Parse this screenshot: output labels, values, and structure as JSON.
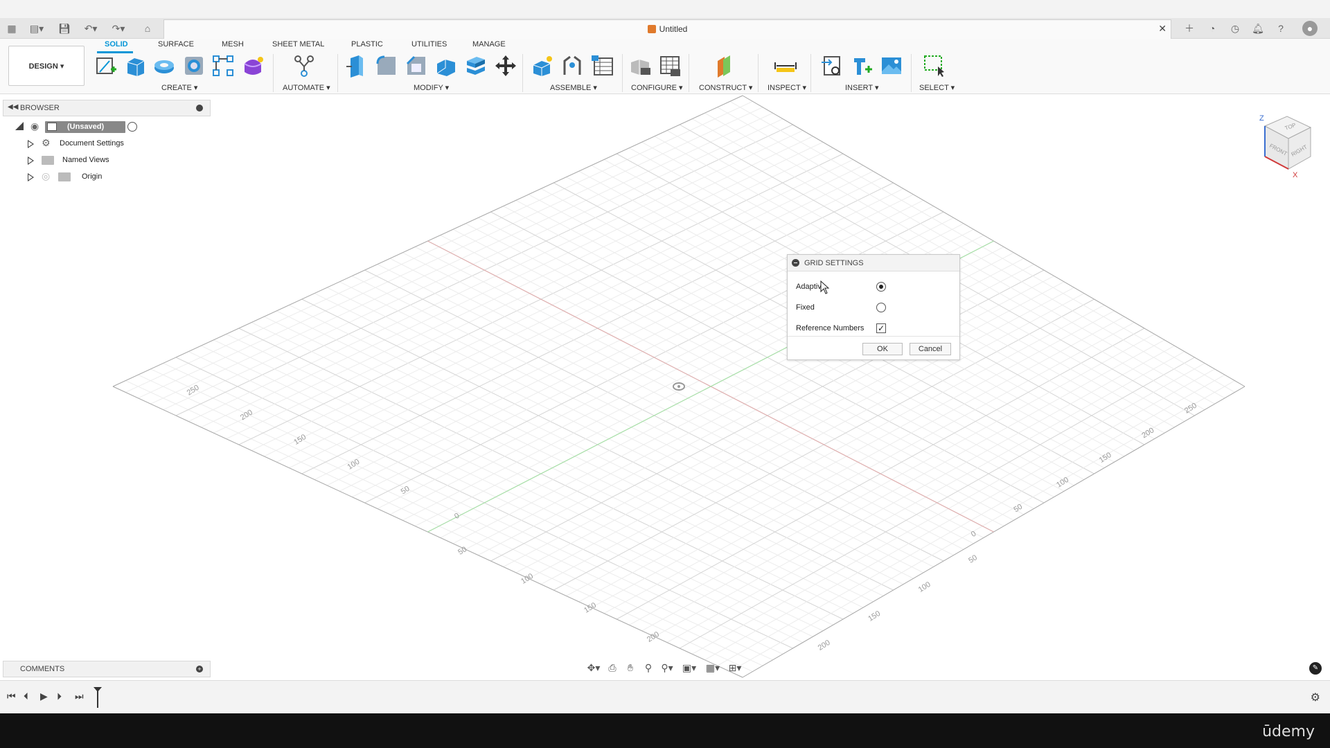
{
  "document": {
    "title": "Untitled"
  },
  "workspace": {
    "label": "DESIGN ▾"
  },
  "tabs": [
    {
      "label": "SOLID",
      "active": true
    },
    {
      "label": "SURFACE"
    },
    {
      "label": "MESH"
    },
    {
      "label": "SHEET METAL"
    },
    {
      "label": "PLASTIC"
    },
    {
      "label": "UTILITIES"
    },
    {
      "label": "MANAGE"
    }
  ],
  "groups": {
    "create": "CREATE ▾",
    "automate": "AUTOMATE ▾",
    "modify": "MODIFY ▾",
    "assemble": "ASSEMBLE ▾",
    "configure": "CONFIGURE ▾",
    "construct": "CONSTRUCT ▾",
    "inspect": "INSPECT ▾",
    "insert": "INSERT ▾",
    "select": "SELECT ▾"
  },
  "browser": {
    "title": "BROWSER",
    "root": "(Unsaved)",
    "items": [
      "Document Settings",
      "Named Views",
      "Origin"
    ]
  },
  "grid_dialog": {
    "title": "GRID SETTINGS",
    "adaptive_label": "Adaptive",
    "fixed_label": "Fixed",
    "refnum_label": "Reference Numbers",
    "adaptive_selected": true,
    "reference_numbers_checked": true,
    "ok_label": "OK",
    "cancel_label": "Cancel"
  },
  "comments": {
    "title": "COMMENTS"
  },
  "viewcube": {
    "top": "TOP",
    "front": "FRONT",
    "right": "RIGHT",
    "z": "Z",
    "x": "X"
  },
  "grid_numbers": {
    "left_axis": [
      "250",
      "200",
      "150",
      "100",
      "50",
      "0"
    ],
    "bottom_left_axis": [
      "50",
      "100",
      "150",
      "200"
    ],
    "right_axis": [
      "250",
      "200",
      "150",
      "100",
      "50",
      "0"
    ],
    "bottom_right_axis": [
      "50",
      "100",
      "150",
      "200"
    ]
  },
  "watermark": "ūdemy"
}
